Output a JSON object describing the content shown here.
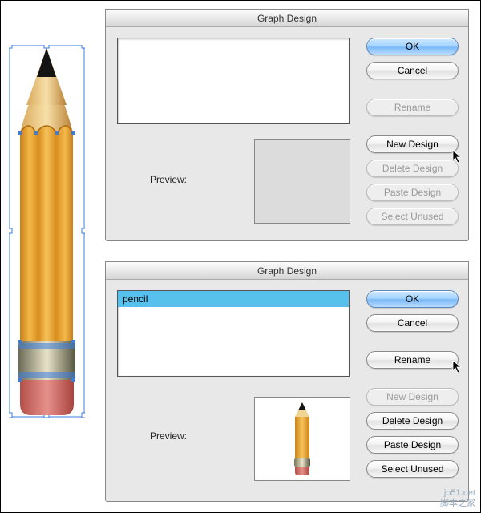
{
  "dialog1": {
    "title": "Graph Design",
    "preview_label": "Preview:",
    "buttons": {
      "ok": "OK",
      "cancel": "Cancel",
      "rename": "Rename",
      "new_design": "New Design",
      "delete_design": "Delete Design",
      "paste_design": "Paste Design",
      "select_unused": "Select Unused"
    }
  },
  "dialog2": {
    "title": "Graph Design",
    "preview_label": "Preview:",
    "list": {
      "item0": "pencil"
    },
    "buttons": {
      "ok": "OK",
      "cancel": "Cancel",
      "rename": "Rename",
      "new_design": "New Design",
      "delete_design": "Delete Design",
      "paste_design": "Paste Design",
      "select_unused": "Select Unused"
    }
  },
  "watermark": {
    "line1": "jb51.net",
    "line2": "脚本之家"
  }
}
